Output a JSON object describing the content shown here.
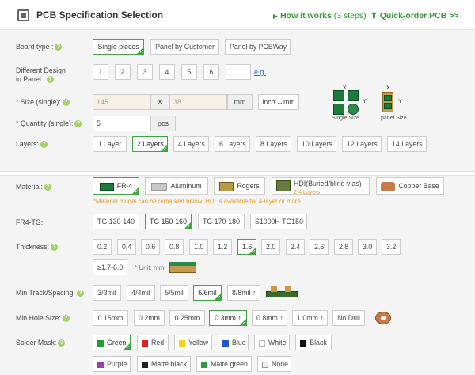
{
  "header": {
    "title": "PCB Specification Selection",
    "how_it_works": "How it works",
    "how_it_works_steps": "(3 steps)",
    "quick_order": "Quick-order PCB >>"
  },
  "board_type": {
    "label": "Board type :",
    "options": [
      "Single pieces",
      "Panel by Customer",
      "Panel by PCBWay"
    ],
    "selected": "Single pieces"
  },
  "different_design": {
    "label_line1": "Different Design",
    "label_line2": "in Panel :",
    "options": [
      "1",
      "2",
      "3",
      "4",
      "5",
      "6"
    ],
    "custom_value": "",
    "eg_link": "e.g."
  },
  "size": {
    "label": "Size (single):",
    "width_placeholder": "145",
    "x": "X",
    "height_placeholder": "38",
    "unit": "mm",
    "convert_button": "inch'↔mm",
    "single_size_caption": "Single Size",
    "panel_size_caption": "panel Size",
    "dim_x": "X",
    "dim_y": "Y"
  },
  "quantity": {
    "label": "Quantity (single):",
    "value": "5",
    "unit": "pcs"
  },
  "layers": {
    "label": "Layers:",
    "options": [
      "1 Layer",
      "2 Layers",
      "4 Layers",
      "6 Layers",
      "8 Layers",
      "10 Layers",
      "12 Layers",
      "14 Layers"
    ],
    "selected": "2 Layers"
  },
  "material": {
    "label": "Material:",
    "options": [
      {
        "name": "FR-4",
        "sub": ""
      },
      {
        "name": "Aluminum",
        "sub": ""
      },
      {
        "name": "Rogers",
        "sub": ""
      },
      {
        "name": "HDI(Buried/blind vias)",
        "sub": "2-4 Layers"
      },
      {
        "name": "Copper Base",
        "sub": ""
      }
    ],
    "selected": "FR-4",
    "note": "*Material model can be remarked below. HDI is available for 4-layer or more."
  },
  "fr4_tg": {
    "label": "FR4-TG:",
    "options": [
      "TG 130-140",
      "TG 150-160",
      "TG 170-180",
      "S1000H TG150"
    ],
    "selected": "TG 150-160"
  },
  "thickness": {
    "label": "Thickness:",
    "options": [
      "0.2",
      "0.4",
      "0.6",
      "0.8",
      "1.0",
      "1.2",
      "1.6",
      "2.0",
      "2.4",
      "2.6",
      "2.8",
      "3.0",
      "3.2",
      "≥1.7-6.0"
    ],
    "selected": "1.6",
    "unit_note": "* Unit: mm"
  },
  "track": {
    "label": "Min Track/Spacing:",
    "options": [
      "3/3mil",
      "4/4mil",
      "5/5mil",
      "6/6mil",
      "8/8mil ↑"
    ],
    "selected": "6/6mil"
  },
  "hole": {
    "label": "Min Hole Size:",
    "options": [
      "0.15mm",
      "0.2mm",
      "0.25mm",
      "0.3mm ↑",
      "0.8mm ↑",
      "1.0mm ↑",
      "No Drill"
    ],
    "selected": "0.3mm ↑"
  },
  "solder_mask": {
    "label": "Solder Mask:",
    "options": [
      {
        "name": "Green",
        "color": "#1f9b3a"
      },
      {
        "name": "Red",
        "color": "#d8232a"
      },
      {
        "name": "Yellow",
        "color": "#f2d21b"
      },
      {
        "name": "Blue",
        "color": "#2357c7"
      },
      {
        "name": "White",
        "color": "#ffffff"
      },
      {
        "name": "Black",
        "color": "#111111"
      },
      {
        "name": "Purple",
        "color": "#9a3fb3"
      },
      {
        "name": "Matte black",
        "color": "#222222"
      },
      {
        "name": "Matte green",
        "color": "#2c9b3f"
      },
      {
        "name": "None",
        "color": "#eeeeee"
      }
    ],
    "selected": "Green"
  },
  "colors": {
    "accent_green": "#3ca640",
    "link_blue": "#2a6cc8",
    "note_orange": "#e89c2a",
    "help_icon": "#a3cf63"
  }
}
